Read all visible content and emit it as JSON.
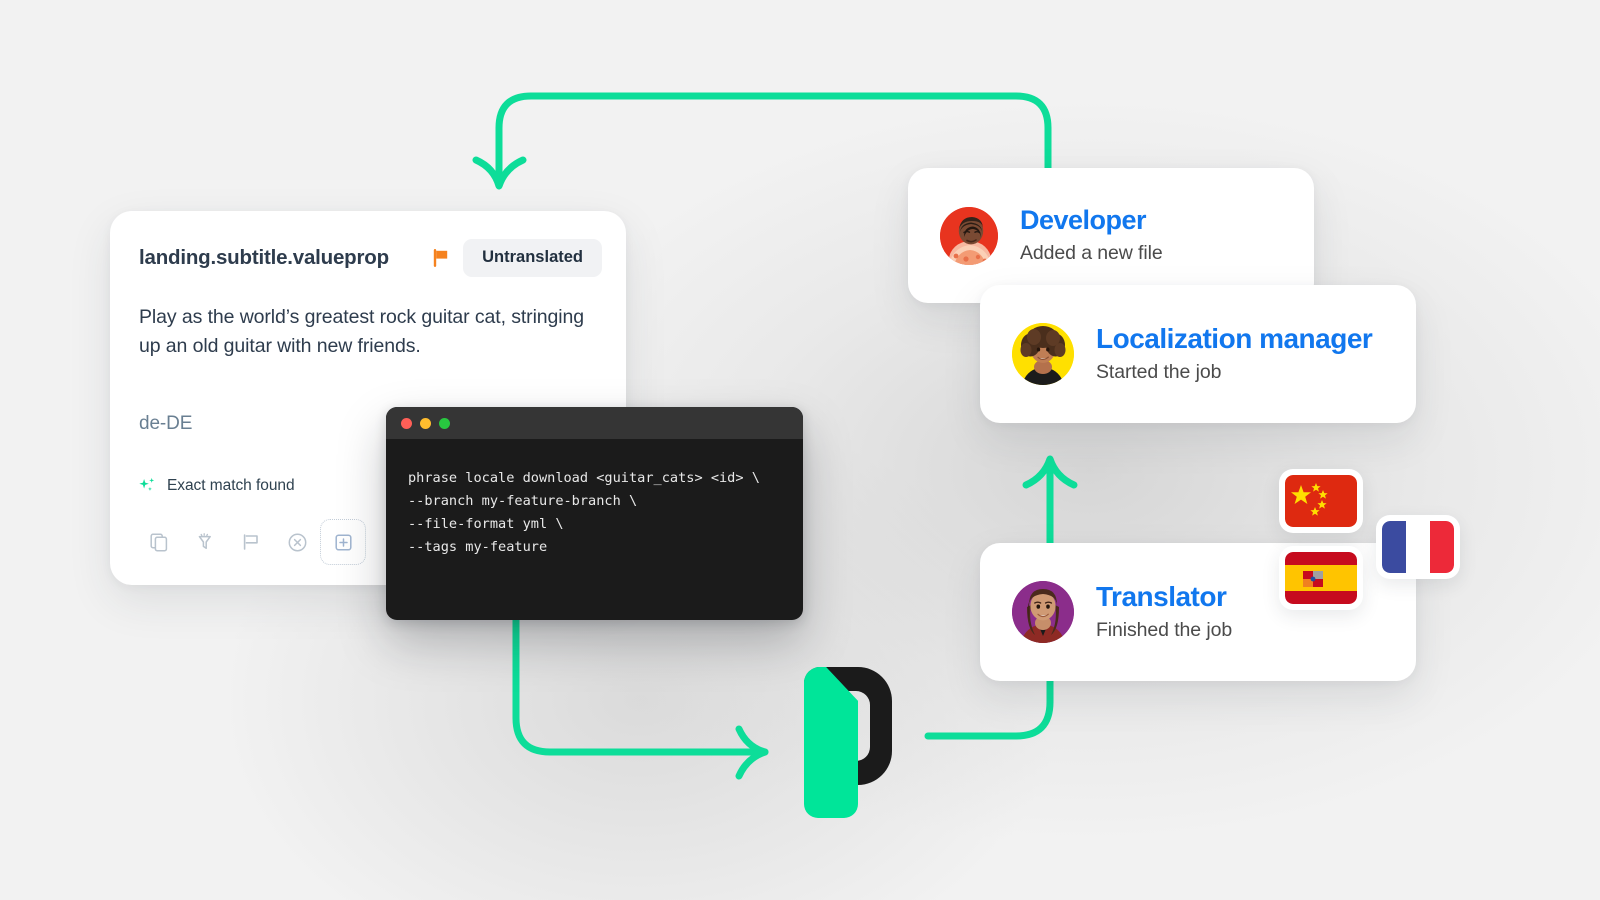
{
  "theme": {
    "background": "#f2f2f2",
    "accent_green": "#0ddd99",
    "link_blue": "#1177ee",
    "text_dark": "#2e3c4d",
    "text_muted": "#697f92",
    "flag_orange": "#f5821f",
    "terminal_bg": "#1b1b1b",
    "terminal_bar": "#353535"
  },
  "segment_card": {
    "key": "landing.subtitle.valueprop",
    "flag_icon": "flag-icon",
    "status": "Untranslated",
    "source_text": "Play as the world’s greatest rock guitar cat, stringing up an old guitar with new friends.",
    "locale": "de-DE",
    "match": {
      "icon": "sparkle-icon",
      "label": "Exact match found"
    },
    "actions": [
      {
        "name": "copy-icon",
        "title": "Copy"
      },
      {
        "name": "translation-memory-icon",
        "title": "Translation memory"
      },
      {
        "name": "flag-outline-icon",
        "title": "Flag"
      },
      {
        "name": "circle-x-icon",
        "title": "Reject"
      },
      {
        "name": "add-plus-icon",
        "title": "Add"
      }
    ]
  },
  "terminal": {
    "dots": [
      "red",
      "yellow",
      "green"
    ],
    "command": "phrase locale download <guitar_cats> <id> \\\n--branch my-feature-branch \\\n--file-format yml \\\n--tags my-feature"
  },
  "roles": [
    {
      "id": "developer",
      "title": "Developer",
      "subtitle": "Added a new file",
      "avatar_name": "avatar-developer",
      "avatar_bg": "#e8341f"
    },
    {
      "id": "manager",
      "title": "Localization manager",
      "subtitle": "Started the job",
      "avatar_name": "avatar-localization-manager",
      "avatar_bg": "#ffe000"
    },
    {
      "id": "translator",
      "title": "Translator",
      "subtitle": "Finished the job",
      "avatar_name": "avatar-translator",
      "avatar_bg": "#8b2d8b"
    }
  ],
  "flags": [
    {
      "id": "cn",
      "name": "flag-china-icon",
      "label": "China"
    },
    {
      "id": "es",
      "name": "flag-spain-icon",
      "label": "Spain"
    },
    {
      "id": "fr",
      "name": "flag-france-icon",
      "label": "France"
    }
  ],
  "logo": {
    "name": "phrase-logo",
    "label": "Phrase"
  }
}
